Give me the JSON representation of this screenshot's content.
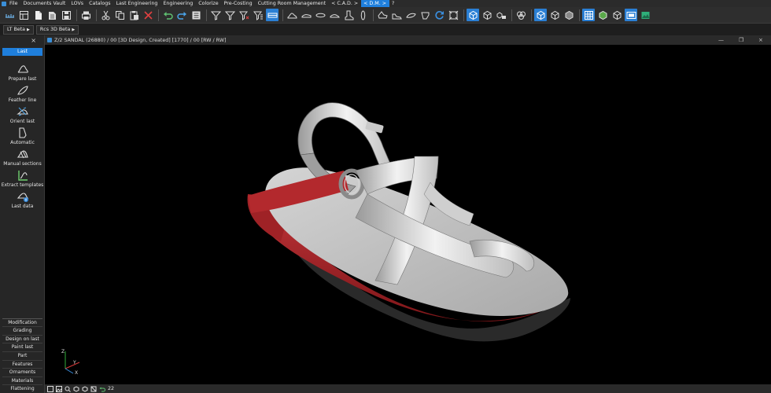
{
  "menubar": {
    "items": [
      {
        "label": "File",
        "active": false
      },
      {
        "label": "Documents Vault",
        "active": false
      },
      {
        "label": "LOVs",
        "active": false
      },
      {
        "label": "Catalogs",
        "active": false
      },
      {
        "label": "Last Engineering",
        "active": false
      },
      {
        "label": "Engineering",
        "active": false
      },
      {
        "label": "Colorize",
        "active": false
      },
      {
        "label": "Pre-Costing",
        "active": false
      },
      {
        "label": "Cutting Room Management",
        "active": false
      },
      {
        "label": "< C.A.D. >",
        "active": false
      },
      {
        "label": "< D.M. >",
        "active": true
      },
      {
        "label": "?",
        "active": false
      }
    ]
  },
  "tabs": [
    {
      "label": "LT Beta"
    },
    {
      "label": "Rcs 3D Beta"
    }
  ],
  "left_panel": {
    "close": "×",
    "header": "Last",
    "tools": [
      {
        "label": "Prepare last",
        "icon": "prepare-last-icon"
      },
      {
        "label": "Feather line",
        "icon": "feather-line-icon"
      },
      {
        "label": "Orient last",
        "icon": "orient-last-icon"
      },
      {
        "label": "Automatic",
        "icon": "automatic-icon"
      },
      {
        "label": "Manual sections",
        "icon": "manual-sections-icon"
      },
      {
        "label": "Extract templates",
        "icon": "extract-templates-icon"
      },
      {
        "label": "Last data",
        "icon": "last-data-icon"
      }
    ],
    "categories": [
      "Modification",
      "Grading",
      "Design on last",
      "Paint last",
      "Part",
      "Features",
      "Ornaments",
      "Materials",
      "Flattening"
    ]
  },
  "document": {
    "title": "Z/2 SANDAL  (26880) / 00  [3D Design, Created] [1770] / 00 [RW / RW]",
    "minimize": "—",
    "restore": "❐",
    "close": "×"
  },
  "axes": {
    "x": "X",
    "y": "Y",
    "z": "Z"
  },
  "statusbar": {
    "zoom_value": "22"
  },
  "colors": {
    "accent": "#1f7fdc",
    "sole_red": "#b3292d",
    "viewport_bg": "#000000"
  }
}
